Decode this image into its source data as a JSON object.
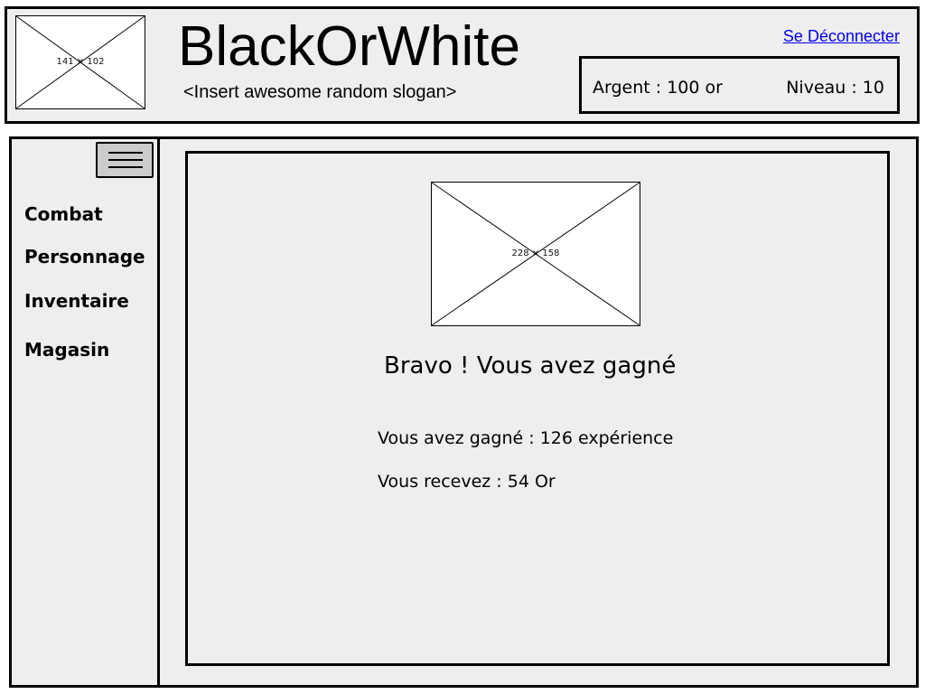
{
  "header": {
    "logo_placeholder": "141 × 102",
    "title": "BlackOrWhite",
    "slogan": "<Insert awesome random slogan>",
    "logout_label": "Se Déconnecter",
    "money": "Argent : 100 or",
    "level": "Niveau : 10"
  },
  "sidebar": {
    "menu_icon": "hamburger-icon",
    "items": [
      {
        "label": "Combat"
      },
      {
        "label": "Personnage"
      },
      {
        "label": "Inventaire"
      },
      {
        "label": "Magasin"
      }
    ]
  },
  "main": {
    "image_placeholder": "228 × 158",
    "title": "Bravo ! Vous avez gagné",
    "xp_line": "Vous avez gagné : 126 expérience",
    "gold_line": "Vous recevez : 54 Or"
  },
  "colors": {
    "panel_background": "#eeeeee",
    "link": "#0000ee",
    "menu_button": "#cccccc"
  }
}
